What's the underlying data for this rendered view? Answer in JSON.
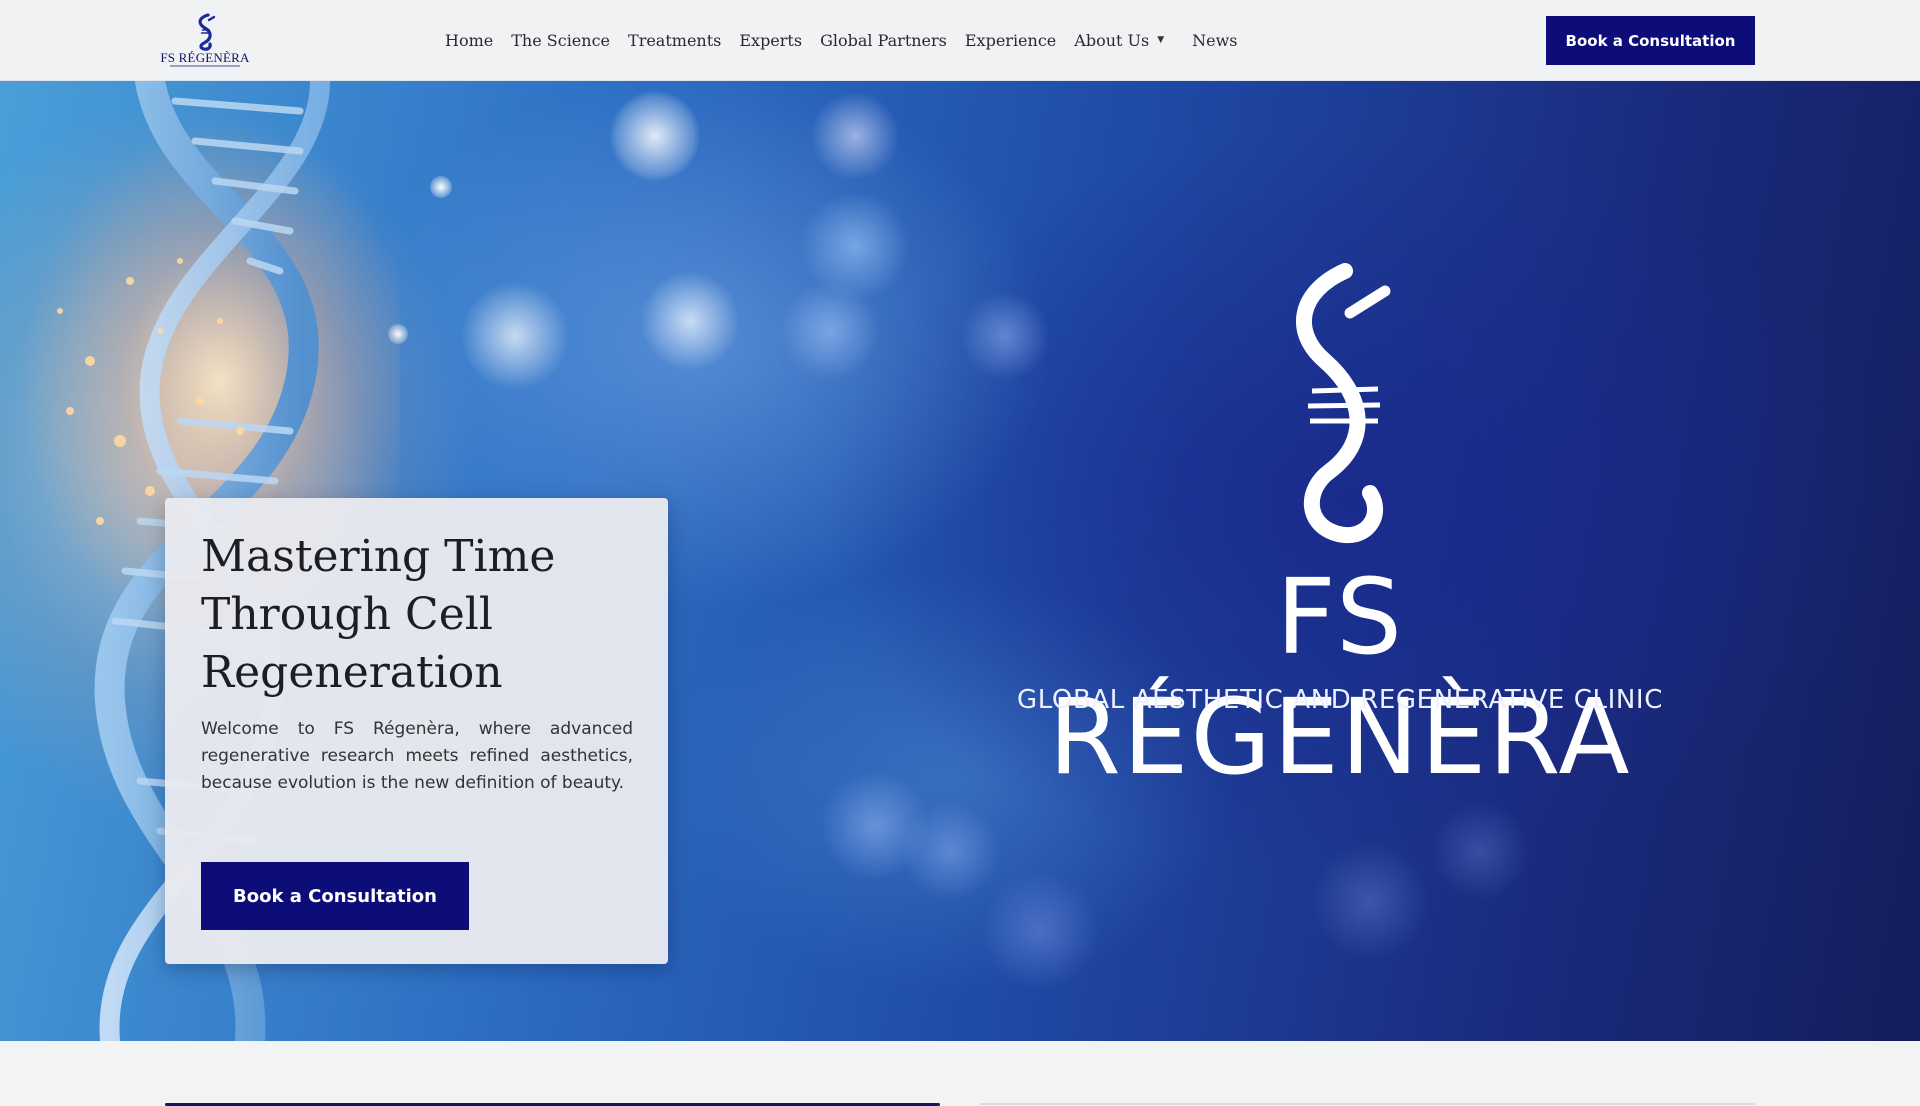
{
  "header": {
    "logo_text": "FS RÉGENÈRA",
    "nav": [
      {
        "label": "Home"
      },
      {
        "label": "The Science"
      },
      {
        "label": "Treatments"
      },
      {
        "label": "Experts"
      },
      {
        "label": "Global Partners"
      },
      {
        "label": "Experience"
      },
      {
        "label": "About Us",
        "has_dropdown": true,
        "icon": "caret-down-icon"
      },
      {
        "label": "News"
      }
    ],
    "cta_label": "Book a Consultation"
  },
  "hero": {
    "title": "Mastering Time Through Cell Regeneration",
    "body": "Welcome to FS Régenèra, where advanced regenerative research meets refined aesthetics, because evolution is the new definition of beauty.",
    "cta_label": "Book a Consultation",
    "brand_name": "FS RÉGENÈRA",
    "brand_tagline": "GLOBAL AESTHETIC AND REGENERATIVE CLINIC"
  },
  "colors": {
    "primary": "#0d0d7a",
    "header_bg": "#f1f2f4",
    "card_bg": "#e8e9ee"
  }
}
